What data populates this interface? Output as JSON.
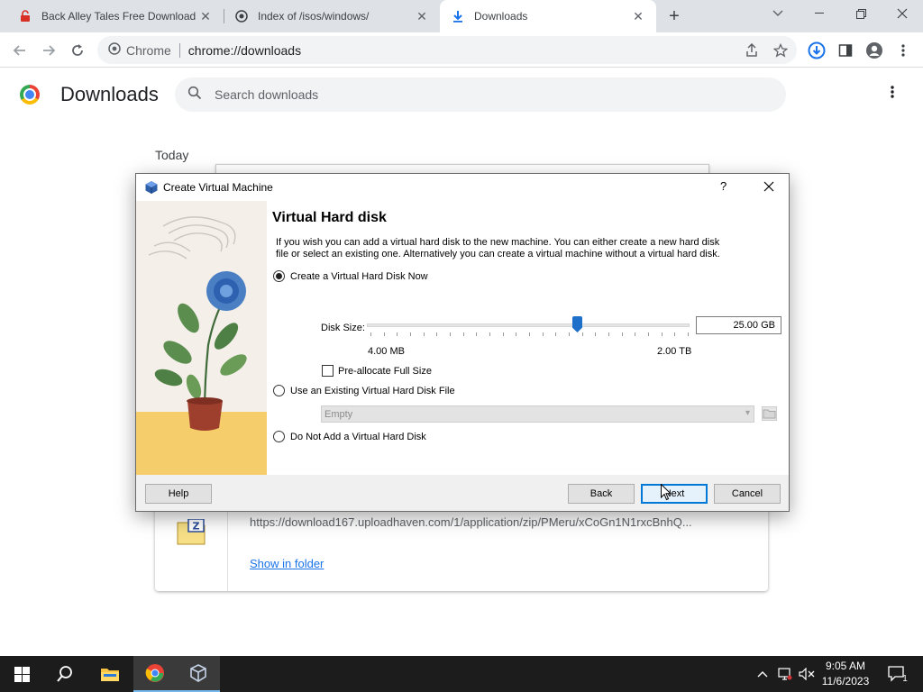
{
  "browser": {
    "tabs": [
      {
        "title": "Back Alley Tales Free Download (",
        "icon": "lock-icon",
        "active": false
      },
      {
        "title": "Index of /isos/windows/",
        "icon": "site-icon",
        "active": false
      },
      {
        "title": "Downloads",
        "icon": "download-icon",
        "active": true
      }
    ],
    "address": {
      "site": "Chrome",
      "url": "chrome://downloads"
    }
  },
  "downloads_page": {
    "title": "Downloads",
    "search_placeholder": "Search downloads",
    "section_label": "Today",
    "item": {
      "url": "https://download167.uploadhaven.com/1/application/zip/PMeru/xCoGn1N1rxcBnhQ...",
      "show_in_folder": "Show in folder"
    }
  },
  "dialog": {
    "window_title": "Create Virtual Machine",
    "help_glyph": "?",
    "heading": "Virtual Hard disk",
    "description": "If you wish you can add a virtual hard disk to the new machine. You can either create a new hard disk file or select an existing one. Alternatively you can create a virtual machine without a virtual hard disk.",
    "options": {
      "create_now": "Create a Virtual Hard Disk Now",
      "use_existing": "Use an Existing Virtual Hard Disk File",
      "do_not_add": "Do Not Add a Virtual Hard Disk"
    },
    "selected_option": "create_now",
    "disk_size_label": "Disk Size:",
    "disk_size_value": "25.00 GB",
    "disk_size_min": "4.00 MB",
    "disk_size_max": "2.00 TB",
    "disk_size_slider_fraction": 0.65,
    "preallocate_label": "Pre-allocate Full Size",
    "preallocate_checked": false,
    "existing_file_combo": "Empty",
    "buttons": {
      "help": "Help",
      "back": "Back",
      "next": "Next",
      "cancel": "Cancel"
    }
  },
  "taskbar": {
    "time": "9:05 AM",
    "date": "11/6/2023",
    "notification_count": "1"
  },
  "colors": {
    "chrome_tabstrip": "#dee1e6",
    "accent_blue": "#1a73e8",
    "dialog_default_button": "#0078d7",
    "taskbar": "#1c1c1c"
  }
}
